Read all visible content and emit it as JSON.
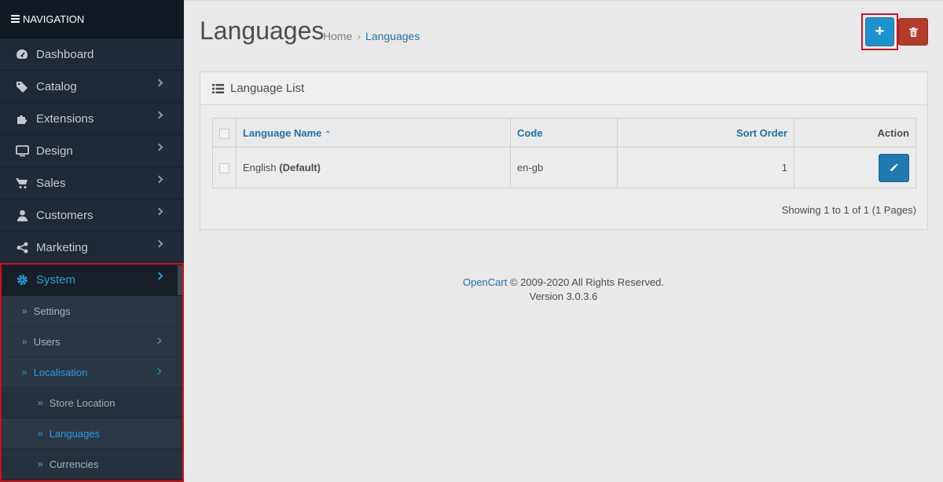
{
  "sidebar": {
    "header": "NAVIGATION",
    "items": [
      {
        "label": "Dashboard",
        "icon": "dashboard-icon"
      },
      {
        "label": "Catalog",
        "icon": "tags-icon"
      },
      {
        "label": "Extensions",
        "icon": "puzzle-icon"
      },
      {
        "label": "Design",
        "icon": "monitor-icon"
      },
      {
        "label": "Sales",
        "icon": "cart-icon"
      },
      {
        "label": "Customers",
        "icon": "user-icon"
      },
      {
        "label": "Marketing",
        "icon": "share-icon"
      },
      {
        "label": "System",
        "icon": "gear-icon"
      }
    ],
    "system_sub": [
      {
        "label": "Settings"
      },
      {
        "label": "Users"
      },
      {
        "label": "Localisation"
      }
    ],
    "localisation_sub": [
      {
        "label": "Store Location"
      },
      {
        "label": "Languages"
      },
      {
        "label": "Currencies"
      }
    ]
  },
  "header": {
    "title": "Languages",
    "breadcrumb": [
      "Home",
      "Languages"
    ]
  },
  "panel": {
    "title": "Language List",
    "columns": [
      "Language Name",
      "Code",
      "Sort Order",
      "Action"
    ],
    "rows": [
      {
        "name": "English",
        "name_suffix": "(Default)",
        "code": "en-gb",
        "sort_order": "1"
      }
    ],
    "pagination": "Showing 1 to 1 of 1 (1 Pages)"
  },
  "footer": {
    "brand": "OpenCart",
    "copyright": " © 2009-2020 All Rights Reserved.",
    "version": "Version 3.0.3.6"
  },
  "colors": {
    "accent": "#1e91cf",
    "danger": "#b53b2d",
    "sidebar_bg": "#1f2a36",
    "active_link": "#2a9ddb"
  }
}
